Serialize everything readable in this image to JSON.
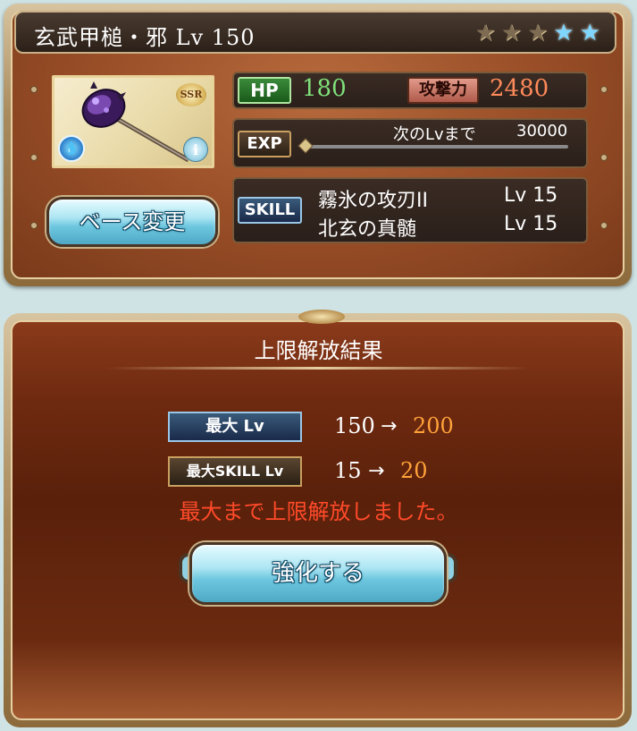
{
  "weapon": {
    "title": "玄武甲槌・邪 Lv 150",
    "rarity": "SSR",
    "element_icon": "water-element-icon",
    "info_label": "i",
    "stars": [
      {
        "icon": "bronze-star-icon",
        "color": "#7d6b52"
      },
      {
        "icon": "bronze-star-icon",
        "color": "#7d6b52"
      },
      {
        "icon": "bronze-star-icon",
        "color": "#7d6b52"
      },
      {
        "icon": "blue-star-icon",
        "color": "#7fd6ff"
      },
      {
        "icon": "blue-star-icon",
        "color": "#7fd6ff"
      }
    ]
  },
  "stats": {
    "hp_label": "HP",
    "hp_value": "180",
    "atk_label": "攻撃力",
    "atk_value": "2480",
    "exp_label": "EXP",
    "exp_next_label": "次のLvまで",
    "exp_next_value": "30000",
    "exp_progress": 0
  },
  "skills": {
    "label": "SKILL",
    "items": [
      {
        "name": "霧氷の攻刃II",
        "level": "Lv 15"
      },
      {
        "name": "北玄の真髄",
        "level": "Lv 15"
      }
    ]
  },
  "buttons": {
    "base_change": "ベース変更",
    "enhance": "強化する"
  },
  "result": {
    "title": "上限解放結果",
    "max_lv_label": "最大 Lv",
    "max_lv_from": "150",
    "max_lv_to": "200",
    "max_skill_label": "最大SKILL Lv",
    "max_skill_from": "15",
    "max_skill_to": "20",
    "arrow": "→",
    "message": "最大まで上限解放しました。"
  },
  "colors": {
    "hp": "#7fe07a",
    "attack": "#ff8a5a",
    "result_to": "#ffa23a",
    "message": "#ff4a2a"
  }
}
